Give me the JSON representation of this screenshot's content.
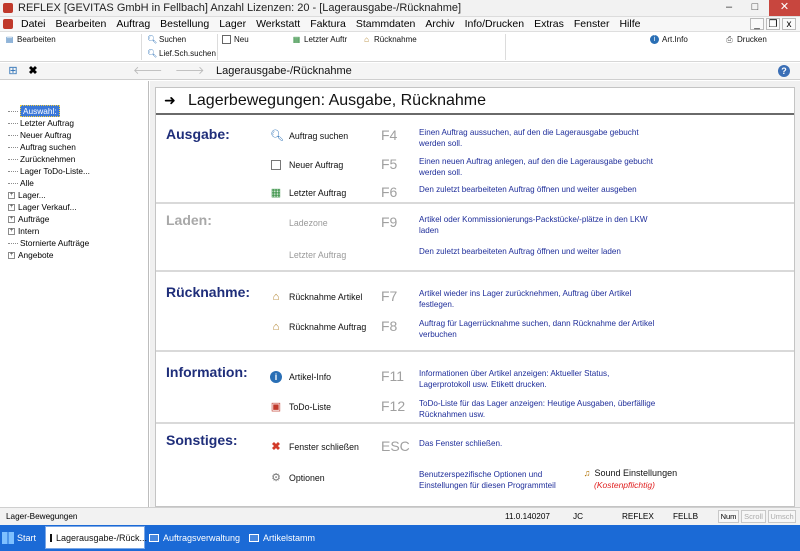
{
  "window": {
    "title": "REFLEX [GEVITAS GmbH in Fellbach] Anzahl Lizenzen: 20 - [Lagerausgabe-/Rücknahme]",
    "min": "–",
    "max": "□",
    "close": "✕"
  },
  "menu": [
    "Datei",
    "Bearbeiten",
    "Auftrag",
    "Bestellung",
    "Lager",
    "Werkstatt",
    "Faktura",
    "Stammdaten",
    "Archiv",
    "Info/Drucken",
    "Extras",
    "Fenster",
    "Hilfe"
  ],
  "mdi": {
    "min": "_",
    "restore": "❐",
    "close": "x"
  },
  "toolbar": {
    "bearbeiten": "Bearbeiten",
    "suchen": "Suchen",
    "lief_sch_suchen": "Lief.Sch.suchen",
    "neu": "Neu",
    "letzter_auftr": "Letzter Auftr",
    "ruecknahme": "Rücknahme",
    "art_info": "Art.Info",
    "drucken": "Drucken"
  },
  "nav": {
    "location": "Lagerausgabe-/Rücknahme",
    "back": "🡐",
    "forward": "🡒",
    "help": "?"
  },
  "tree": [
    {
      "label": "Auswahl:",
      "type": "leaf",
      "selected": true
    },
    {
      "label": "Letzter Auftrag",
      "type": "leaf"
    },
    {
      "label": "Neuer Auftrag",
      "type": "leaf"
    },
    {
      "label": "Auftrag suchen",
      "type": "leaf"
    },
    {
      "label": "Zurücknehmen",
      "type": "leaf"
    },
    {
      "label": "Lager ToDo-Liste...",
      "type": "leaf"
    },
    {
      "label": "Alle",
      "type": "leaf"
    },
    {
      "label": "Lager...",
      "type": "node"
    },
    {
      "label": "Lager Verkauf...",
      "type": "node"
    },
    {
      "label": "Aufträge",
      "type": "node"
    },
    {
      "label": "Intern",
      "type": "node"
    },
    {
      "label": "Stornierte Aufträge",
      "type": "leaf"
    },
    {
      "label": "Angebote",
      "type": "node"
    }
  ],
  "main": {
    "heading": "Lagerbewegungen: Ausgabe, Rücknahme",
    "sections": {
      "ausgabe": {
        "title": "Ausgabe:",
        "rows": [
          {
            "label": "Auftrag suchen",
            "key": "F4",
            "desc": "Einen Auftrag aussuchen, auf den die Lagerausgabe gebucht werden soll."
          },
          {
            "label": "Neuer Auftrag",
            "key": "F5",
            "desc": "Einen neuen Auftrag anlegen, auf den die Lagerausgabe gebucht  werden soll."
          },
          {
            "label": "Letzter Auftrag",
            "key": "F6",
            "desc": "Den zuletzt bearbeiteten Auftrag öffnen und weiter ausgeben"
          }
        ]
      },
      "laden": {
        "title": "Laden:",
        "rows": [
          {
            "label": "Ladezone",
            "key": "F9",
            "desc": "Artikel oder Kommissionierungs-Packstücke/-plätze  in den LKW laden"
          },
          {
            "label": "Letzter Auftrag",
            "key": "",
            "desc": "Den zuletzt bearbeiteten Auftrag öffnen und weiter laden"
          }
        ]
      },
      "ruecknahme": {
        "title": "Rücknahme:",
        "rows": [
          {
            "label": "Rücknahme Artikel",
            "key": "F7",
            "desc": "Artikel wieder ins Lager zurücknehmen, Auftrag über Artikel festlegen."
          },
          {
            "label": "Rücknahme Auftrag",
            "key": "F8",
            "desc": "Auftrag für Lagerrücknahme suchen, dann Rücknahme der Artikel verbuchen"
          }
        ]
      },
      "information": {
        "title": "Information:",
        "rows": [
          {
            "label": "Artikel-Info",
            "key": "F11",
            "desc": "Informationen über Artikel anzeigen: Aktueller Status, Lagerprotokoll usw. Etikett drucken."
          },
          {
            "label": "ToDo-Liste",
            "key": "F12",
            "desc": "ToDo-Liste für das Lager anzeigen: Heutige Ausgaben, überfällige Rücknahmen usw."
          }
        ]
      },
      "sonstiges": {
        "title": "Sonstiges:",
        "rows": [
          {
            "label": "Fenster schließen",
            "key": "ESC",
            "desc": "Das Fenster schließen."
          },
          {
            "label": "Optionen",
            "key": "",
            "desc": "Benutzerspezifische Optionen und Einstellungen für diesen Programmteil"
          }
        ],
        "sound": "Sound Einstellungen",
        "kosten": "(Kostenpflichtig)"
      }
    }
  },
  "status": {
    "left": "Lager-Bewegungen",
    "version": "11.0.140207",
    "user": "JC",
    "app": "REFLEX",
    "branch": "FELLB",
    "num": "Num",
    "scroll": "Scroll",
    "umsch": "Umsch"
  },
  "taskbar": {
    "start": "Start",
    "items": [
      "Lagerausgabe-/Rück...",
      "Auftragsverwaltung",
      "Artikelstamm"
    ]
  },
  "icons": {
    "accent": "#1f2e7a",
    "desc_color": "#1f2e9a",
    "taskbar": "#1b6ad6",
    "close_red": "#c8463e",
    "kosten_red": "#e02020"
  }
}
